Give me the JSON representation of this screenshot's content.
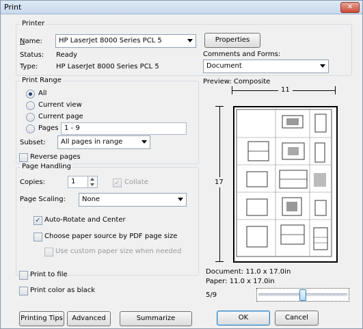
{
  "window": {
    "title": "Print",
    "close_glyph": "✕"
  },
  "printer": {
    "legend": "Printer",
    "name_label": "Name:",
    "name_value": "HP LaserJet 8000 Series PCL 5",
    "status_label": "Status:",
    "status_value": "Ready",
    "type_label": "Type:",
    "type_value": "HP LaserJet 8000 Series PCL 5",
    "properties_label": "Properties",
    "comments_label": "Comments and Forms:",
    "comments_value": "Document"
  },
  "print_range": {
    "legend": "Print Range",
    "all": "All",
    "current_view": "Current view",
    "current_page": "Current page",
    "pages": "Pages",
    "pages_value": "1 - 9",
    "subset_label": "Subset:",
    "subset_value": "All pages in range",
    "reverse_pages": "Reverse pages"
  },
  "page_handling": {
    "legend": "Page Handling",
    "copies_label": "Copies:",
    "copies_value": "1",
    "collate": "Collate",
    "scaling_label": "Page Scaling:",
    "scaling_value": "None",
    "auto_rotate": "Auto-Rotate and Center",
    "choose_source": "Choose paper source by PDF page size",
    "custom_size": "Use custom paper size when needed"
  },
  "options": {
    "print_to_file": "Print to file",
    "print_color_black": "Print color as black"
  },
  "preview": {
    "label": "Preview: Composite",
    "width_label": "11",
    "height_label": "17",
    "document_size": "Document: 11.0 x 17.0in",
    "paper_size": "Paper: 11.0 x 17.0in",
    "page_counter": "5/9",
    "page_position": {
      "current": 5,
      "total": 9
    }
  },
  "buttons": {
    "printing_tips": "Printing Tips",
    "advanced": "Advanced",
    "summarize": "Summarize Comments",
    "ok": "OK",
    "cancel": "Cancel"
  }
}
